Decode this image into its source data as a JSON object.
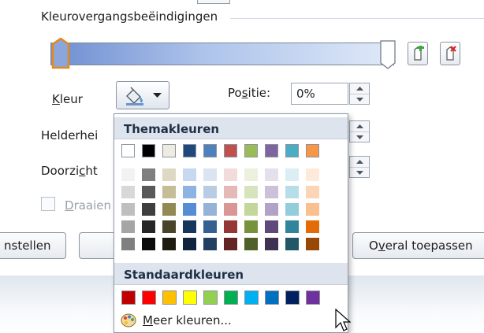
{
  "section": {
    "title": "Kleurovergangsbeëindigingen"
  },
  "kleur": {
    "prefix": "",
    "accel": "K",
    "rest": "leur"
  },
  "positie": {
    "pre": "Po",
    "accel": "s",
    "post": "itie:",
    "value": "0%"
  },
  "helderheid": {
    "label": "Helderhei"
  },
  "doorzichtigheid": {
    "pre": "Doorzi",
    "accel": "c",
    "post": "ht"
  },
  "draaien": {
    "accel": "D",
    "rest": "raaien"
  },
  "buttons": {
    "left": "nstellen",
    "apply_all_pre": "O",
    "apply_all_accel": "v",
    "apply_all_post": "eral toepassen"
  },
  "dropdown": {
    "theme_header": "Themakleuren",
    "standard_header": "Standaardkleuren",
    "more_accel": "M",
    "more_rest": "eer kleuren..."
  },
  "theme_colors": [
    "#ffffff",
    "#000000",
    "#eeece1",
    "#1f497d",
    "#4f81bd",
    "#c0504d",
    "#9bbb59",
    "#8064a2",
    "#4bacc6",
    "#f79646"
  ],
  "theme_tints": [
    [
      "#f2f2f2",
      "#d8d8d8",
      "#bfbfbf",
      "#a5a5a5",
      "#7f7f7f"
    ],
    [
      "#7f7f7f",
      "#595959",
      "#3f3f3f",
      "#262626",
      "#0c0c0c"
    ],
    [
      "#ddd9c3",
      "#c4bd97",
      "#938953",
      "#494429",
      "#1d1b10"
    ],
    [
      "#c6d9f0",
      "#8db3e2",
      "#548dd4",
      "#17365d",
      "#0f243e"
    ],
    [
      "#dbe5f1",
      "#b8cce4",
      "#95b3d7",
      "#366092",
      "#244061"
    ],
    [
      "#f2dcdb",
      "#e5b9b7",
      "#d99694",
      "#953734",
      "#632423"
    ],
    [
      "#ebf1dd",
      "#d7e3bc",
      "#c3d69b",
      "#76923c",
      "#4f6128"
    ],
    [
      "#e5e0ec",
      "#ccc1d9",
      "#b2a2c7",
      "#5f497a",
      "#3f3151"
    ],
    [
      "#dbeef3",
      "#b7dde8",
      "#92cddc",
      "#31859b",
      "#205867"
    ],
    [
      "#fdeada",
      "#fbd5b5",
      "#fac08f",
      "#e36c09",
      "#974806"
    ]
  ],
  "standard_colors": [
    "#c00000",
    "#ff0000",
    "#ffc000",
    "#ffff00",
    "#92d050",
    "#00b050",
    "#00b0f0",
    "#0070c0",
    "#002060",
    "#7030a0"
  ]
}
